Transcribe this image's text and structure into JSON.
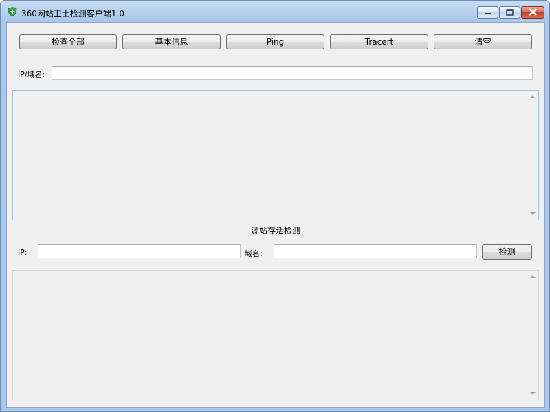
{
  "window": {
    "title": "360网站卫士检测客户端1.0",
    "icon": "green-shield-icon",
    "controls": [
      "minimize",
      "maximize",
      "close"
    ]
  },
  "toolbar": {
    "buttons": [
      {
        "label": "检查全部"
      },
      {
        "label": "基本信息"
      },
      {
        "label": "Ping"
      },
      {
        "label": "Tracert"
      },
      {
        "label": "清空"
      }
    ]
  },
  "domain_input": {
    "label": "IP/域名:",
    "value": ""
  },
  "origin_check": {
    "section_title": "源站存活检测",
    "ip_label": "IP:",
    "ip_value": "",
    "domain_label": "域名:",
    "domain_value": "",
    "check_button": "检测"
  },
  "colors": {
    "titlebar": "#a9c8ea",
    "client_bg": "#f0f0f0",
    "close_button": "#c2402c",
    "icon_green": "#2eaa3d"
  }
}
